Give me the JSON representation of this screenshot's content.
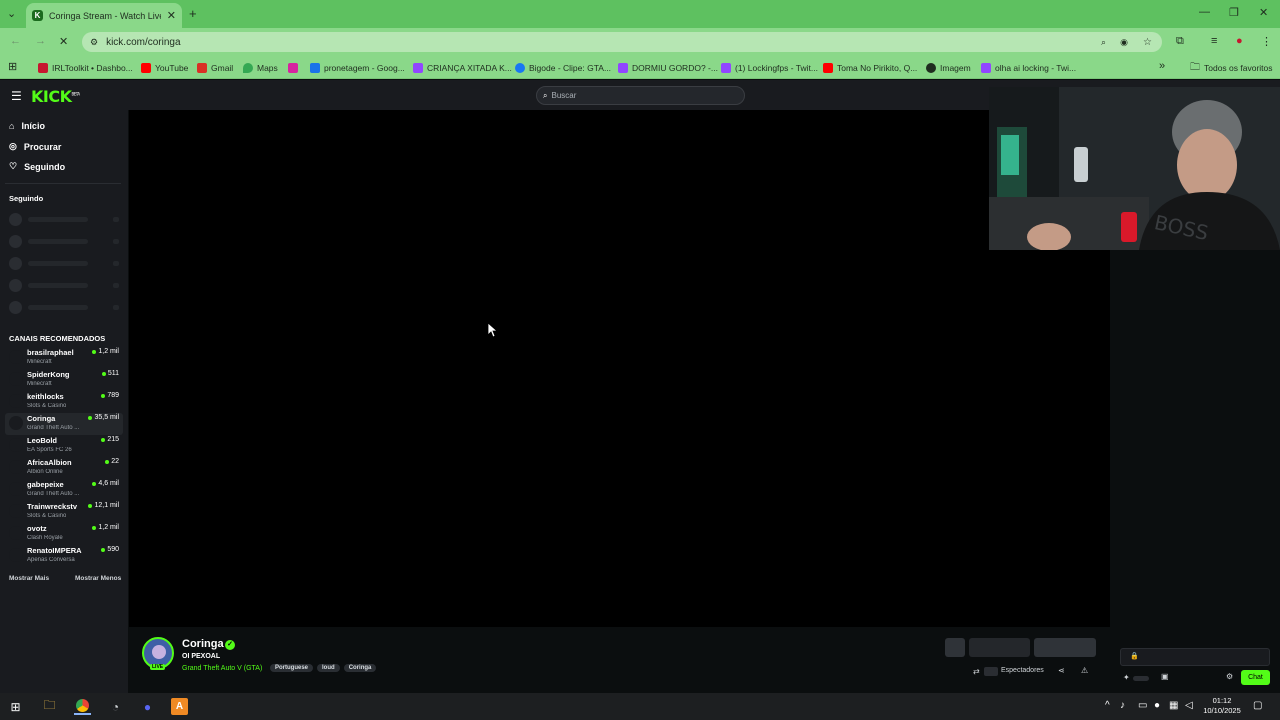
{
  "browser": {
    "tab_title": "Coringa Stream - Watch Live o",
    "url": "kick.com/coringa",
    "new_tab_glyph": "+",
    "bookmarks": [
      {
        "label": "IRLToolkit • Dashbo...",
        "icon": "irltoolkit-icon",
        "color": "#c6172f"
      },
      {
        "label": "YouTube",
        "icon": "youtube-icon",
        "color": "#ff0000"
      },
      {
        "label": "Gmail",
        "icon": "gmail-icon",
        "color": "#d93025"
      },
      {
        "label": "Maps",
        "icon": "maps-icon",
        "color": "#34a853"
      },
      {
        "label": "",
        "icon": "instagram-icon",
        "color": "#d6249f"
      },
      {
        "label": "pronetagem - Goog...",
        "icon": "google-drive-icon",
        "color": "#1a73e8"
      },
      {
        "label": "CRIANÇA XITADA K...",
        "icon": "twitch-icon",
        "color": "#9146ff"
      },
      {
        "label": "Bigode - Clipe: GTA...",
        "icon": "facebook-icon",
        "color": "#1877f2"
      },
      {
        "label": "DORMIU GORDO? -...",
        "icon": "twitch-icon",
        "color": "#9146ff"
      },
      {
        "label": "(1) Lockingfps - Twit...",
        "icon": "twitch-icon",
        "color": "#9146ff"
      },
      {
        "label": "Toma No Pirikito, Q...",
        "icon": "youtube-icon",
        "color": "#ff0000"
      },
      {
        "label": "Imagem",
        "icon": "globe-icon",
        "color": "#1f2d1f"
      },
      {
        "label": "olha ai locking - Twi...",
        "icon": "twitch-icon",
        "color": "#9146ff"
      }
    ],
    "all_bookmarks": "Todos os favoritos"
  },
  "kick": {
    "logo": "KICK",
    "logo_badge": "BETA",
    "search_placeholder": "Buscar",
    "nav": [
      {
        "label": "Início",
        "icon": "home-icon"
      },
      {
        "label": "Procurar",
        "icon": "compass-icon"
      },
      {
        "label": "Seguindo",
        "icon": "heart-icon"
      }
    ],
    "following_title": "Seguindo",
    "recommended_title": "CANAIS RECOMENDADOS",
    "channels": [
      {
        "name": "brasilraphael",
        "category": "Minecraft",
        "viewers": "1,2 mil"
      },
      {
        "name": "SpiderKong",
        "category": "Minecraft",
        "viewers": "511"
      },
      {
        "name": "keithlocks",
        "category": "Slots & Casino",
        "viewers": "789"
      },
      {
        "name": "Coringa",
        "category": "Grand Theft Auto ...",
        "viewers": "35,5 mil"
      },
      {
        "name": "LeoBold",
        "category": "EA Sports FC 26",
        "viewers": "215"
      },
      {
        "name": "AfricaAlbion",
        "category": "Albion Online",
        "viewers": "22"
      },
      {
        "name": "gabepeixe",
        "category": "Grand Theft Auto ...",
        "viewers": "4,6 mil"
      },
      {
        "name": "Trainwreckstv",
        "category": "Slots & Casino",
        "viewers": "12,1 mil"
      },
      {
        "name": "ovotz",
        "category": "Clash Royale",
        "viewers": "1,2 mil"
      },
      {
        "name": "RenatoIMPERA",
        "category": "Apenas Conversa",
        "viewers": "590"
      }
    ],
    "show_more": "Mostrar Mais",
    "show_less": "Mostrar Menos",
    "streamer": {
      "name": "Coringa",
      "title": "OI PEXOAL",
      "category": "Grand Theft Auto V (GTA)",
      "tags": [
        "Portuguese",
        "loud",
        "Coringa"
      ],
      "live_badge": "LIVE"
    },
    "viewers_label": "Espectadores",
    "chat_button": "Chat"
  },
  "taskbar": {
    "time": "01:12",
    "date": "10/10/2025"
  },
  "colors": {
    "kick_green": "#53fc18",
    "chrome_green": "#8ad889",
    "tab_strip": "#5ec160"
  }
}
